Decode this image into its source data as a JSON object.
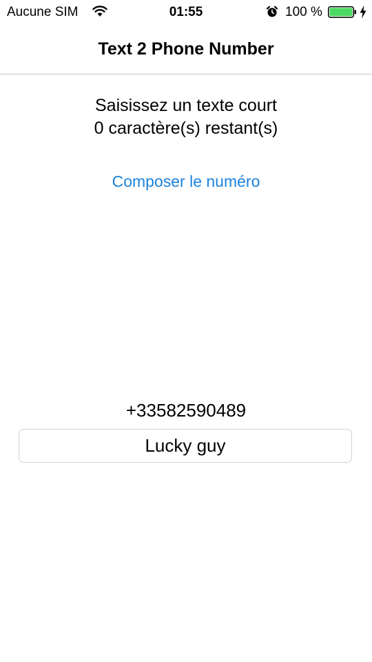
{
  "status_bar": {
    "carrier": "Aucune SIM",
    "time": "01:55",
    "battery_percent": "100 %",
    "battery_level": 1.0,
    "icons": [
      "wifi-icon",
      "alarm-clock-icon",
      "battery-icon",
      "charging-bolt-icon"
    ]
  },
  "nav": {
    "title": "Text 2 Phone Number"
  },
  "main": {
    "prompt_line1": "Saisissez un texte court",
    "prompt_line2": "0 caractère(s) restant(s)",
    "compose_link": "Composer le numéro",
    "phone_number": "+33582590489",
    "text_input_value": "Lucky guy"
  },
  "colors": {
    "link_blue": "#1a82dc",
    "battery_green": "#4cd964",
    "separator": "#c8c7cc"
  }
}
